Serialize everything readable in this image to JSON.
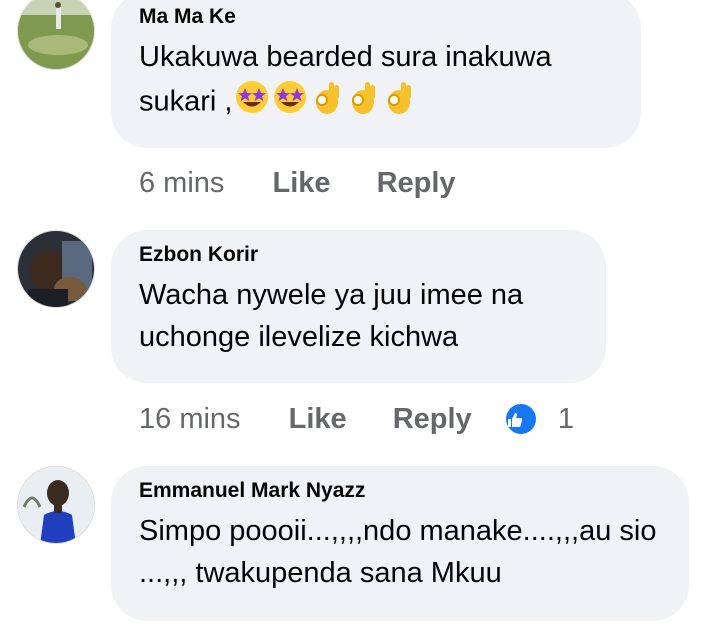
{
  "comments": [
    {
      "author": "Ma Ma Ke",
      "text": "Ukakuwa bearded sura inakuwa sukari ,",
      "emojis": [
        "star-struck-emoji",
        "star-struck-emoji",
        "ok-hand-emoji",
        "ok-hand-emoji",
        "ok-hand-emoji"
      ],
      "time": "6 mins",
      "like_label": "Like",
      "reply_label": "Reply"
    },
    {
      "author": "Ezbon Korir",
      "text": "Wacha nywele ya juu imee na uchonge  ilevelize kichwa",
      "time": "16 mins",
      "like_label": "Like",
      "reply_label": "Reply",
      "reaction_count": "1",
      "reaction_icon": "like-reaction-icon"
    },
    {
      "author": "Emmanuel Mark Nyazz",
      "text": "Simpo poooii...,,,,ndo manake....,,,au sio ...,,, twakupenda sana Mkuu"
    }
  ],
  "colors": {
    "bubble": "#f0f2f5",
    "meta": "#65676b",
    "like_blue": "#1877f2"
  }
}
